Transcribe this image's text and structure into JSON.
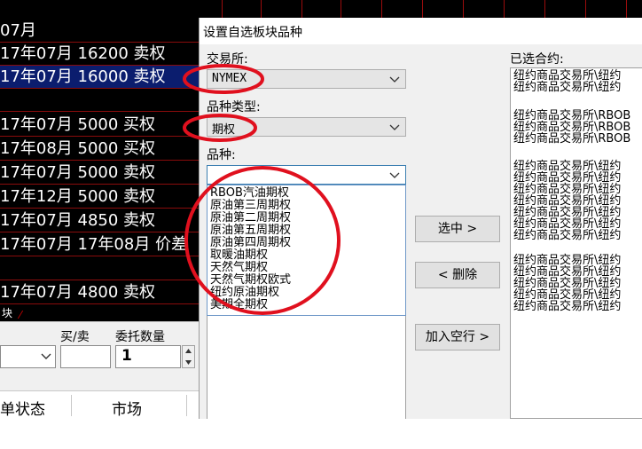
{
  "background": {
    "rows": [
      {
        "text": "07月",
        "selected": false
      },
      {
        "text": "17年07月 16200 卖权",
        "selected": false
      },
      {
        "text": "17年07月 16000 卖权",
        "selected": true
      },
      {
        "text": "",
        "selected": false
      },
      {
        "text": "17年07月 5000 买权",
        "selected": false
      },
      {
        "text": "17年08月 5000 买权",
        "selected": false
      },
      {
        "text": "17年07月 5000 卖权",
        "selected": false
      },
      {
        "text": "17年12月 5000 卖权",
        "selected": false
      },
      {
        "text": "17年07月 4850 卖权",
        "selected": false
      },
      {
        "text": "17年07月 17年08月 价差",
        "selected": false
      },
      {
        "text": "",
        "selected": false
      },
      {
        "text": "17年07月 4800 卖权",
        "selected": false
      }
    ],
    "tab_label": "块",
    "order": {
      "side_label": "买/卖",
      "qty_label": "委托数量",
      "qty_value": "1",
      "col_status": "单状态",
      "col_market": "市场"
    }
  },
  "dialog": {
    "title": "设置自选板块品种",
    "exchange_label": "交易所:",
    "exchange_value": "NYMEX",
    "type_label": "品种类型:",
    "type_value": "期权",
    "variety_label": "品种:",
    "variety_value": "",
    "variety_options": [
      "RBOB汽油期权",
      "原油第三周期权",
      "原油第二周期权",
      "原油第五周期权",
      "原油第四周期权",
      "取暖油期权",
      "天然气期权",
      "天然气期权欧式",
      "纽约原油期权",
      "美期全期权"
    ],
    "buttons": {
      "select": "选中 >",
      "delete": "< 删除",
      "add_blank": "加入空行 >"
    },
    "selected_label": "已选合约:",
    "selected_groups": [
      [
        "纽约商品交易所\\纽约",
        "纽约商品交易所\\纽约"
      ],
      [
        "纽约商品交易所\\RBOB",
        "纽约商品交易所\\RBOB",
        "纽约商品交易所\\RBOB"
      ],
      [
        "纽约商品交易所\\纽约",
        "纽约商品交易所\\纽约",
        "纽约商品交易所\\纽约",
        "纽约商品交易所\\纽约",
        "纽约商品交易所\\纽约",
        "纽约商品交易所\\纽约",
        "纽约商品交易所\\纽约"
      ],
      [
        "纽约商品交易所\\纽约",
        "纽约商品交易所\\纽约",
        "纽约商品交易所\\纽约",
        "纽约商品交易所\\纽约",
        "纽约商品交易所\\纽约"
      ]
    ]
  },
  "colors": {
    "annotation": "#e0101e",
    "selection": "#0b1d6e",
    "grid_line": "#8a0c0c"
  }
}
